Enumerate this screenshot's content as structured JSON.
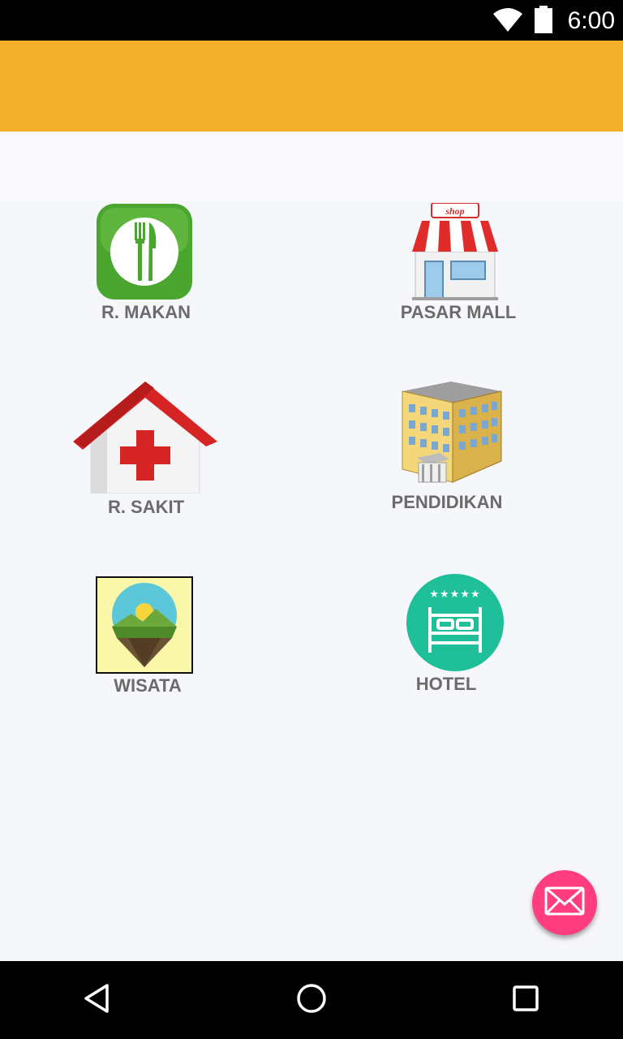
{
  "status_bar": {
    "time": "6:00",
    "icons": [
      "wifi-icon",
      "battery-icon"
    ]
  },
  "app_bar": {
    "color": "#f3b02a"
  },
  "menu": {
    "items": [
      {
        "label": "R. MAKAN",
        "icon": "restaurant-icon"
      },
      {
        "label": "PASAR MALL",
        "icon": "shop-icon"
      },
      {
        "label": "R. SAKIT",
        "icon": "hospital-icon"
      },
      {
        "label": "PENDIDIKAN",
        "icon": "school-building-icon"
      },
      {
        "label": "WISATA",
        "icon": "tourism-location-icon"
      },
      {
        "label": "HOTEL",
        "icon": "hotel-bed-icon"
      }
    ]
  },
  "fab": {
    "icon": "mail-icon",
    "color": "#ff3d7f"
  },
  "nav_bar": {
    "icons": [
      "back-icon",
      "home-icon",
      "recents-icon"
    ]
  }
}
